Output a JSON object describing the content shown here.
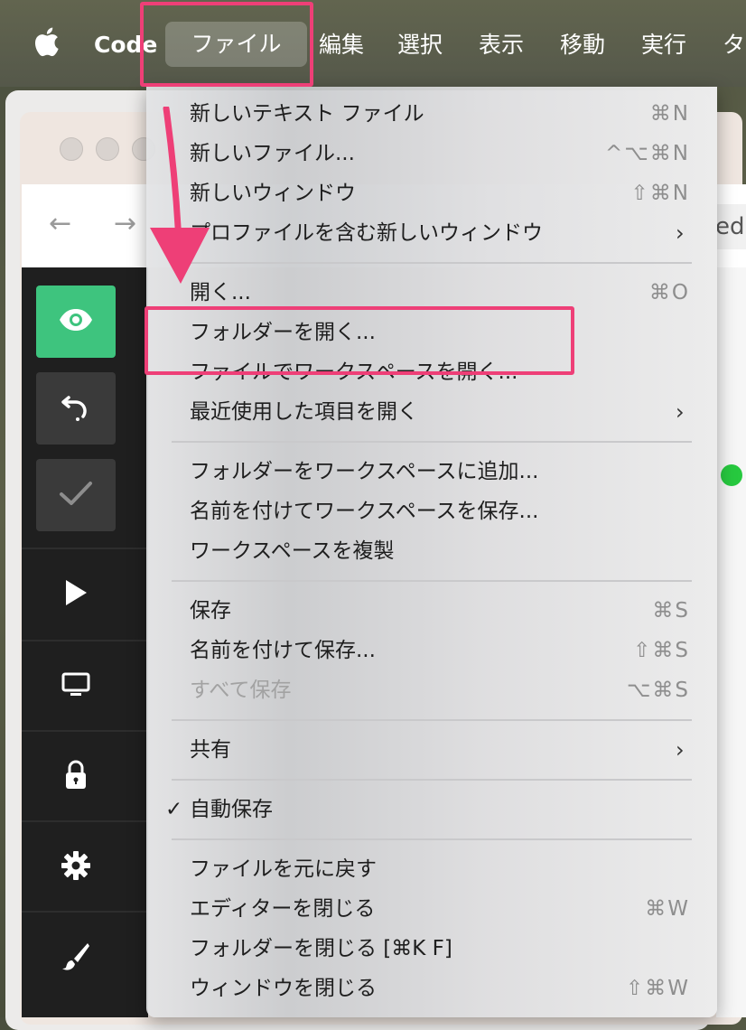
{
  "menubar": {
    "apple_icon": "apple-logo-icon",
    "app_name": "Code",
    "items": [
      "ファイル",
      "編集",
      "選択",
      "表示",
      "移動",
      "実行",
      "タ"
    ]
  },
  "background": {
    "edit_fragment": "edit",
    "nav_back_icon": "arrow-left-icon",
    "nav_forward_icon": "arrow-right-icon"
  },
  "sidebar": {
    "icons": [
      "eye-icon",
      "undo-icon",
      "check-icon",
      "play-icon",
      "monitor-icon",
      "lock-icon",
      "gear-icon",
      "brush-icon"
    ],
    "accent": "#3ec47e"
  },
  "menu": {
    "items": [
      {
        "label": "新しいテキスト ファイル",
        "shortcut": "⌘N"
      },
      {
        "label": "新しいファイル...",
        "shortcut": "^⌥⌘N"
      },
      {
        "label": "新しいウィンドウ",
        "shortcut": "⇧⌘N"
      },
      {
        "label": "プロファイルを含む新しいウィンドウ",
        "shortcut": ""
      },
      {
        "label": "開く...",
        "shortcut": "⌘O"
      },
      {
        "label": "フォルダーを開く...",
        "shortcut": ""
      },
      {
        "label": "ファイルでワークスペースを開く...",
        "shortcut": ""
      },
      {
        "label": "最近使用した項目を開く",
        "shortcut": ""
      },
      {
        "label": "フォルダーをワークスペースに追加...",
        "shortcut": ""
      },
      {
        "label": "名前を付けてワークスペースを保存...",
        "shortcut": ""
      },
      {
        "label": "ワークスペースを複製",
        "shortcut": ""
      },
      {
        "label": "保存",
        "shortcut": "⌘S"
      },
      {
        "label": "名前を付けて保存...",
        "shortcut": "⇧⌘S"
      },
      {
        "label": "すべて保存",
        "shortcut": "⌥⌘S"
      },
      {
        "label": "共有",
        "shortcut": ""
      },
      {
        "label": "自動保存",
        "shortcut": ""
      },
      {
        "label": "ファイルを元に戻す",
        "shortcut": ""
      },
      {
        "label": "エディターを閉じる",
        "shortcut": "⌘W"
      },
      {
        "label": "フォルダーを閉じる [⌘K F]",
        "shortcut": ""
      },
      {
        "label": "ウィンドウを閉じる",
        "shortcut": "⇧⌘W"
      }
    ],
    "submenu_icon": "chevron-right-icon",
    "checkmark_icon": "checkmark-icon"
  },
  "annotations": {
    "highlight_color": "#ee3f77",
    "highlighted": [
      "ファイル",
      "フォルダーを開く..."
    ]
  }
}
